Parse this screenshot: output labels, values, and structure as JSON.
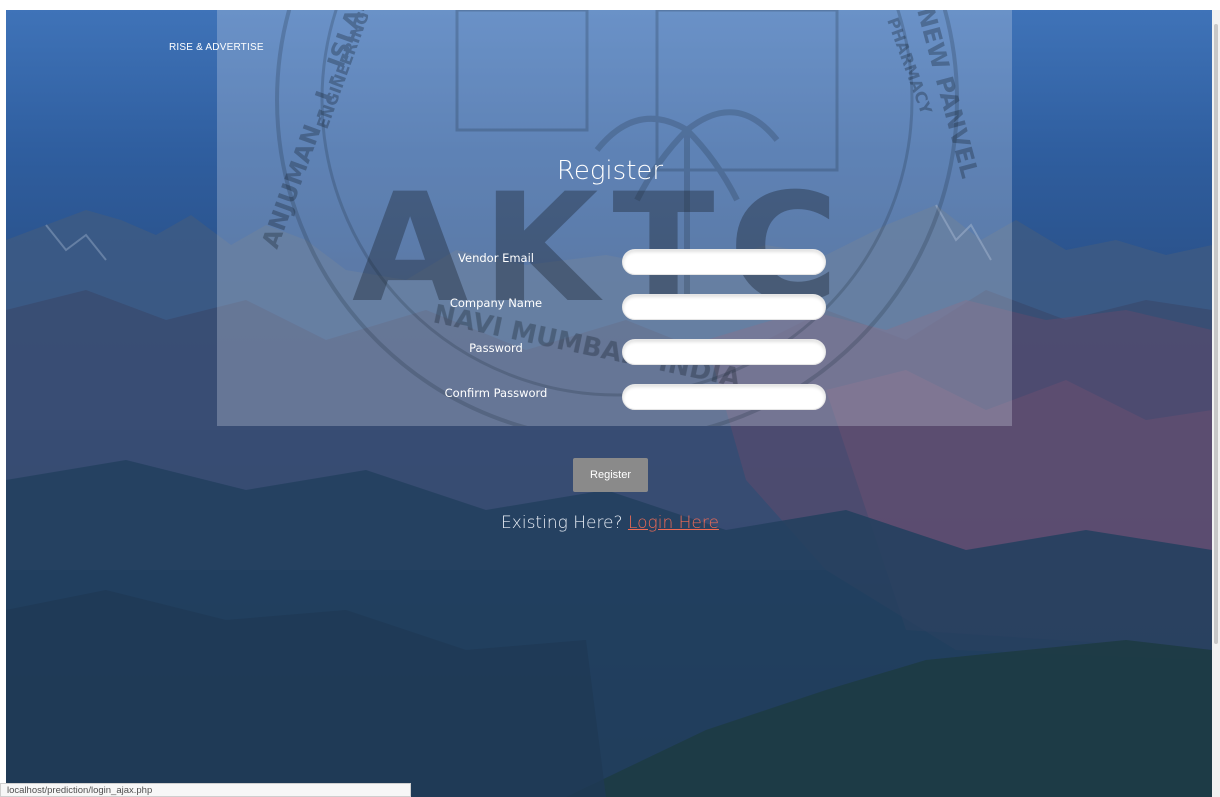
{
  "brand": "RISE & ADVERTISE",
  "emblem_text": [
    "AKTC",
    "ANJUMAN - I - ISLAM",
    "ENGINEERING",
    "NEW PANVEL",
    "PHARMACY",
    "NAVI MUMBAI - INDIA"
  ],
  "form": {
    "title": "Register",
    "fields": [
      {
        "label": "Vendor Email",
        "value": "",
        "type": "email"
      },
      {
        "label": "Company Name",
        "value": "",
        "type": "text"
      },
      {
        "label": "Password",
        "value": "",
        "type": "password"
      },
      {
        "label": "Confirm Password",
        "value": "",
        "type": "password"
      }
    ],
    "submit_label": "Register"
  },
  "footer": {
    "existing_text": "Existing Here?",
    "login_link": "Login Here"
  },
  "status_bar_url": "localhost/prediction/login_ajax.php",
  "colors": {
    "link": "#f06b55",
    "button": "#8a8a8a",
    "sky": "#3f73b8",
    "mountain": "#1f3f63"
  }
}
